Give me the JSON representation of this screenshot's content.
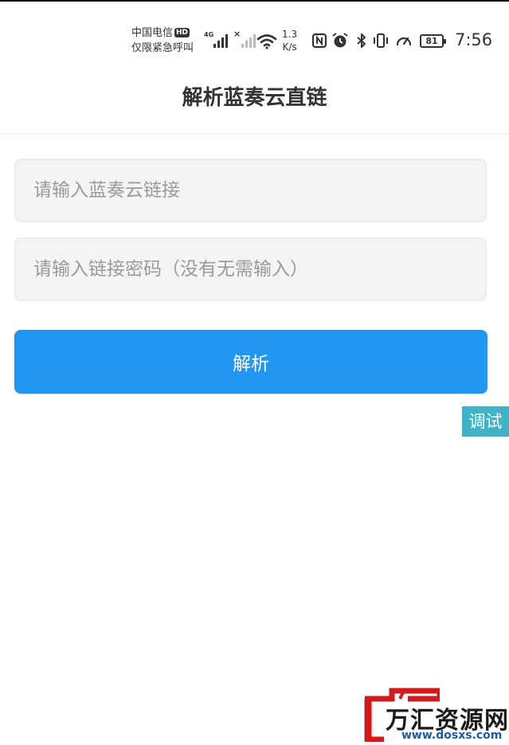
{
  "status_bar": {
    "carrier_line1": "中国电信",
    "hd_badge": "HD",
    "carrier_line2": "仅限紧急呼叫",
    "signal1_tag": "4G",
    "signal2_tag": "×",
    "speed_value": "1.3",
    "speed_unit": "K/s",
    "battery_level": "81",
    "time": "7:56",
    "icons": [
      "nfc-icon",
      "alarm-icon",
      "bluetooth-icon",
      "vibrate-icon",
      "speedometer-icon"
    ]
  },
  "header": {
    "title": "解析蓝奏云直链"
  },
  "form": {
    "link_placeholder": "请输入蓝奏云链接",
    "password_placeholder": "请输入链接密码（没有无需输入）",
    "parse_label": "解析"
  },
  "debug": {
    "label": "调试"
  },
  "watermark": {
    "title": "万汇资源网",
    "url": "www.dosxs.com"
  },
  "colors": {
    "primary": "#2196f3",
    "debug": "#3fb4c8",
    "input_bg": "#f4f4f4",
    "placeholder": "#9a9a9a"
  }
}
